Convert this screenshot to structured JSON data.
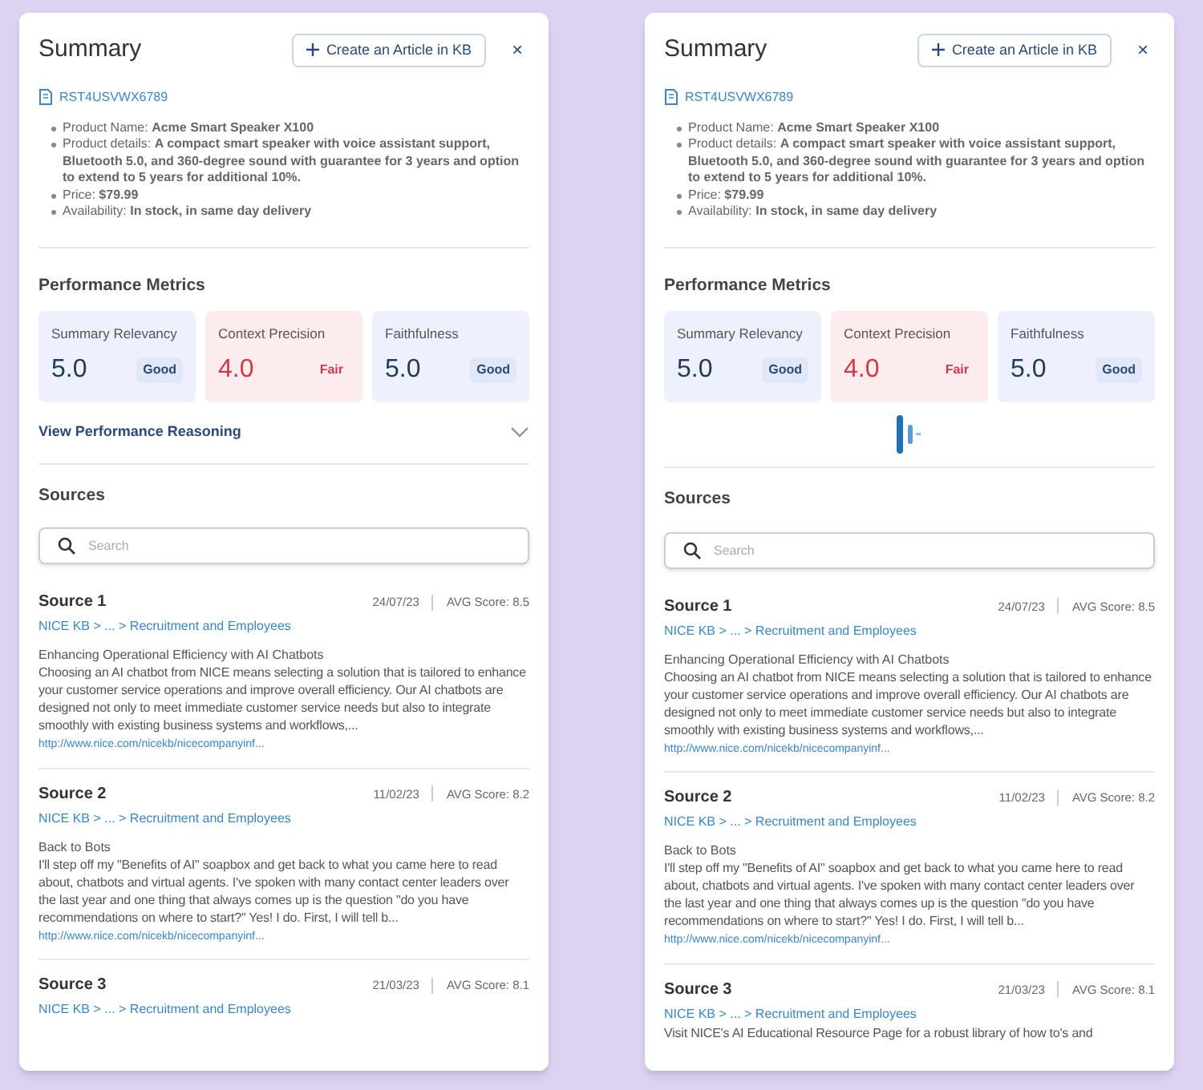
{
  "panels": [
    {
      "title": "Summary",
      "create_button": "Create an Article in KB",
      "close": "×",
      "record_id": "RST4USVWX6789",
      "details": [
        "Product Name: **Acme Smart Speaker X100**",
        "Product details: **A compact smart speaker with voice assistant support, Bluetooth 5.0, and 360-degree sound with guarantee for 3 years and option to extend to 5 years for additional 10%.**",
        "Price: **$79.99**",
        "Availability: **In stock, in same day delivery**"
      ],
      "metrics_title": "Performance Metrics",
      "metrics": [
        {
          "name": "Summary Relevancy",
          "value": "5.0",
          "rating": "Good",
          "kind": "good"
        },
        {
          "name": "Context Precision",
          "value": "4.0",
          "rating": "Fair",
          "kind": "fair"
        },
        {
          "name": "Faithfulness",
          "value": "5.0",
          "rating": "Good",
          "kind": "good"
        }
      ],
      "reasoning": {
        "kind": "link",
        "label": "View Performance Reasoning"
      },
      "sources_title": "Sources",
      "search": {
        "placeholder": "Search"
      },
      "sources": [
        {
          "title": "Source 1",
          "date": "24/07/23",
          "score": "AVG Score: 8.5",
          "path": "NICE KB > ... > Recruitment and Employees",
          "heading": "Enhancing Operational Efficiency with AI Chatbots",
          "body": "Choosing an AI chatbot from NICE means selecting a solution that is tailored to enhance your customer service operations and improve overall efficiency. Our AI chatbots are designed not only to meet immediate customer service needs but also to integrate smoothly with existing business systems and workflows,...",
          "url": "http://www.nice.com/nicekb/nicecompanyinf..."
        },
        {
          "title": "Source 2",
          "date": "11/02/23",
          "score": "AVG Score: 8.2",
          "path": "NICE KB > ... > Recruitment and Employees",
          "heading": "Back to Bots",
          "body": "I'll step off my \"Benefits of AI\" soapbox and get back to what you came here to read about, chatbots and virtual agents. I've spoken with many contact center leaders over the last year and one thing that always comes up is the question \"do you have recommendations on where to start?\" Yes! I do. First, I will tell b...",
          "url": "http://www.nice.com/nicekb/nicecompanyinf..."
        },
        {
          "title": "Source 3",
          "date": "21/03/23",
          "score": "AVG Score: 8.1",
          "path": "NICE KB > ... > Recruitment and Employees"
        }
      ]
    },
    {
      "title": "Summary",
      "create_button": "Create an Article in KB",
      "close": "×",
      "record_id": "RST4USVWX6789",
      "details": [
        "Product Name: **Acme Smart Speaker X100**",
        "Product details: **A compact smart speaker with voice assistant support, Bluetooth 5.0, and 360-degree sound with guarantee for 3 years and option to extend to 5 years for additional 10%.**",
        "Price: **$79.99**",
        "Availability: **In stock, in same day delivery**"
      ],
      "metrics_title": "Performance Metrics",
      "metrics": [
        {
          "name": "Summary Relevancy",
          "value": "5.0",
          "rating": "Good",
          "kind": "good"
        },
        {
          "name": "Context Precision",
          "value": "4.0",
          "rating": "Fair",
          "kind": "fair"
        },
        {
          "name": "Faithfulness",
          "value": "5.0",
          "rating": "Good",
          "kind": "good"
        }
      ],
      "reasoning": {
        "kind": "loading"
      },
      "sources_title": "Sources",
      "search": {
        "placeholder": "Search"
      },
      "sources": [
        {
          "title": "Source 1",
          "date": "24/07/23",
          "score": "AVG Score: 8.5",
          "path": "NICE KB > ... > Recruitment and Employees",
          "heading": "Enhancing Operational Efficiency with AI Chatbots",
          "body": "Choosing an AI chatbot from NICE means selecting a solution that is tailored to enhance your customer service operations and improve overall efficiency. Our AI chatbots are designed not only to meet immediate customer service needs but also to integrate smoothly with existing business systems and workflows,...",
          "url": "http://www.nice.com/nicekb/nicecompanyinf..."
        },
        {
          "title": "Source 2",
          "date": "11/02/23",
          "score": "AVG Score: 8.2",
          "path": "NICE KB > ... > Recruitment and Employees",
          "heading": "Back to Bots",
          "body": "I'll step off my \"Benefits of AI\" soapbox and get back to what you came here to read about, chatbots and virtual agents. I've spoken with many contact center leaders over the last year and one thing that always comes up is the question \"do you have recommendations on where to start?\" Yes! I do. First, I will tell b...",
          "url": "http://www.nice.com/nicekb/nicecompanyinf..."
        },
        {
          "title": "Source 3",
          "date": "21/03/23",
          "score": "AVG Score: 8.1",
          "path": "NICE KB > ... > Recruitment and Employees",
          "body": "Visit NICE's AI Educational Resource Page for a robust library of how to's and"
        }
      ]
    }
  ]
}
